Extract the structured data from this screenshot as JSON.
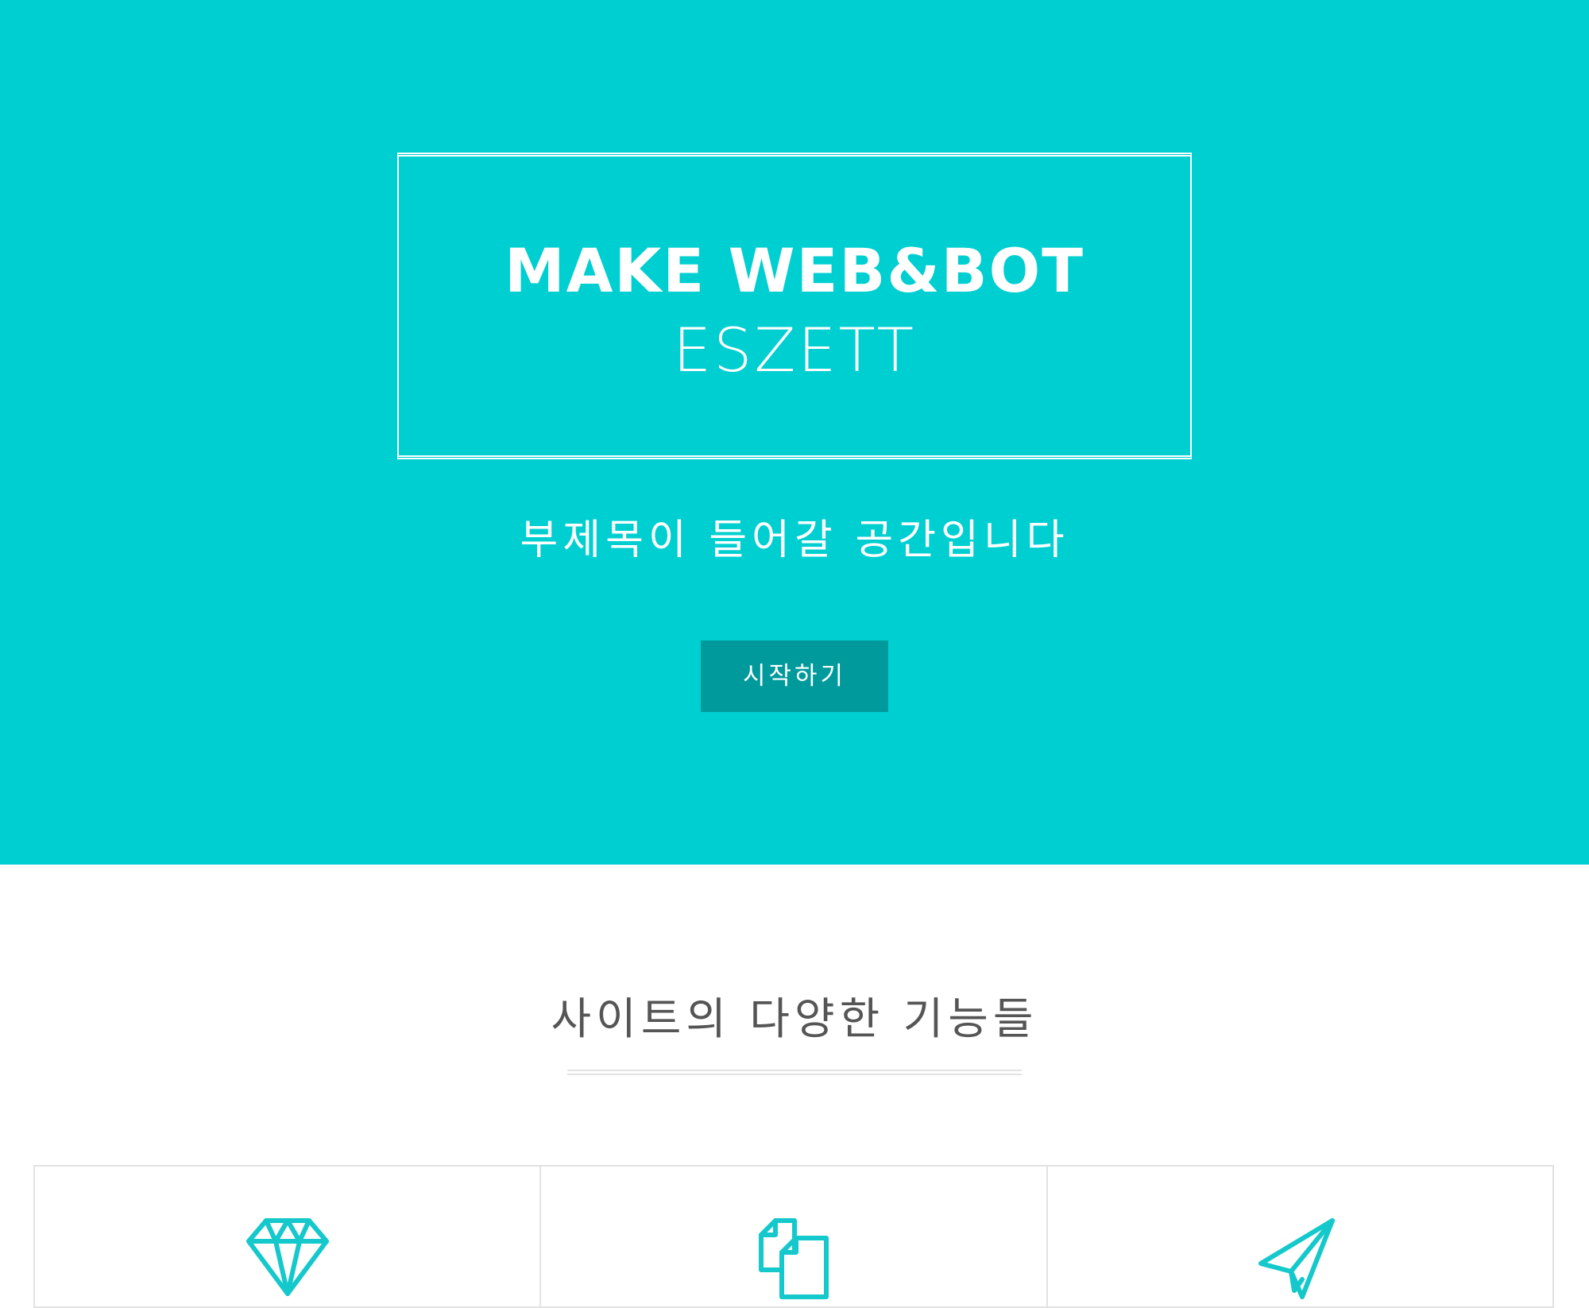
{
  "hero": {
    "title": "MAKE WEB&BOT",
    "name": "ESZETT",
    "subtitle": "부제목이 들어갈 공간입니다",
    "start_button": "시작하기",
    "background_color": "#00cfd1",
    "button_color": "#009a9c"
  },
  "features": {
    "heading": "사이트의 다양한 기능들",
    "icon_color": "#14c8cb",
    "cards": [
      {
        "icon": "diamond-icon"
      },
      {
        "icon": "copy-documents-icon"
      },
      {
        "icon": "paper-plane-icon"
      }
    ]
  }
}
